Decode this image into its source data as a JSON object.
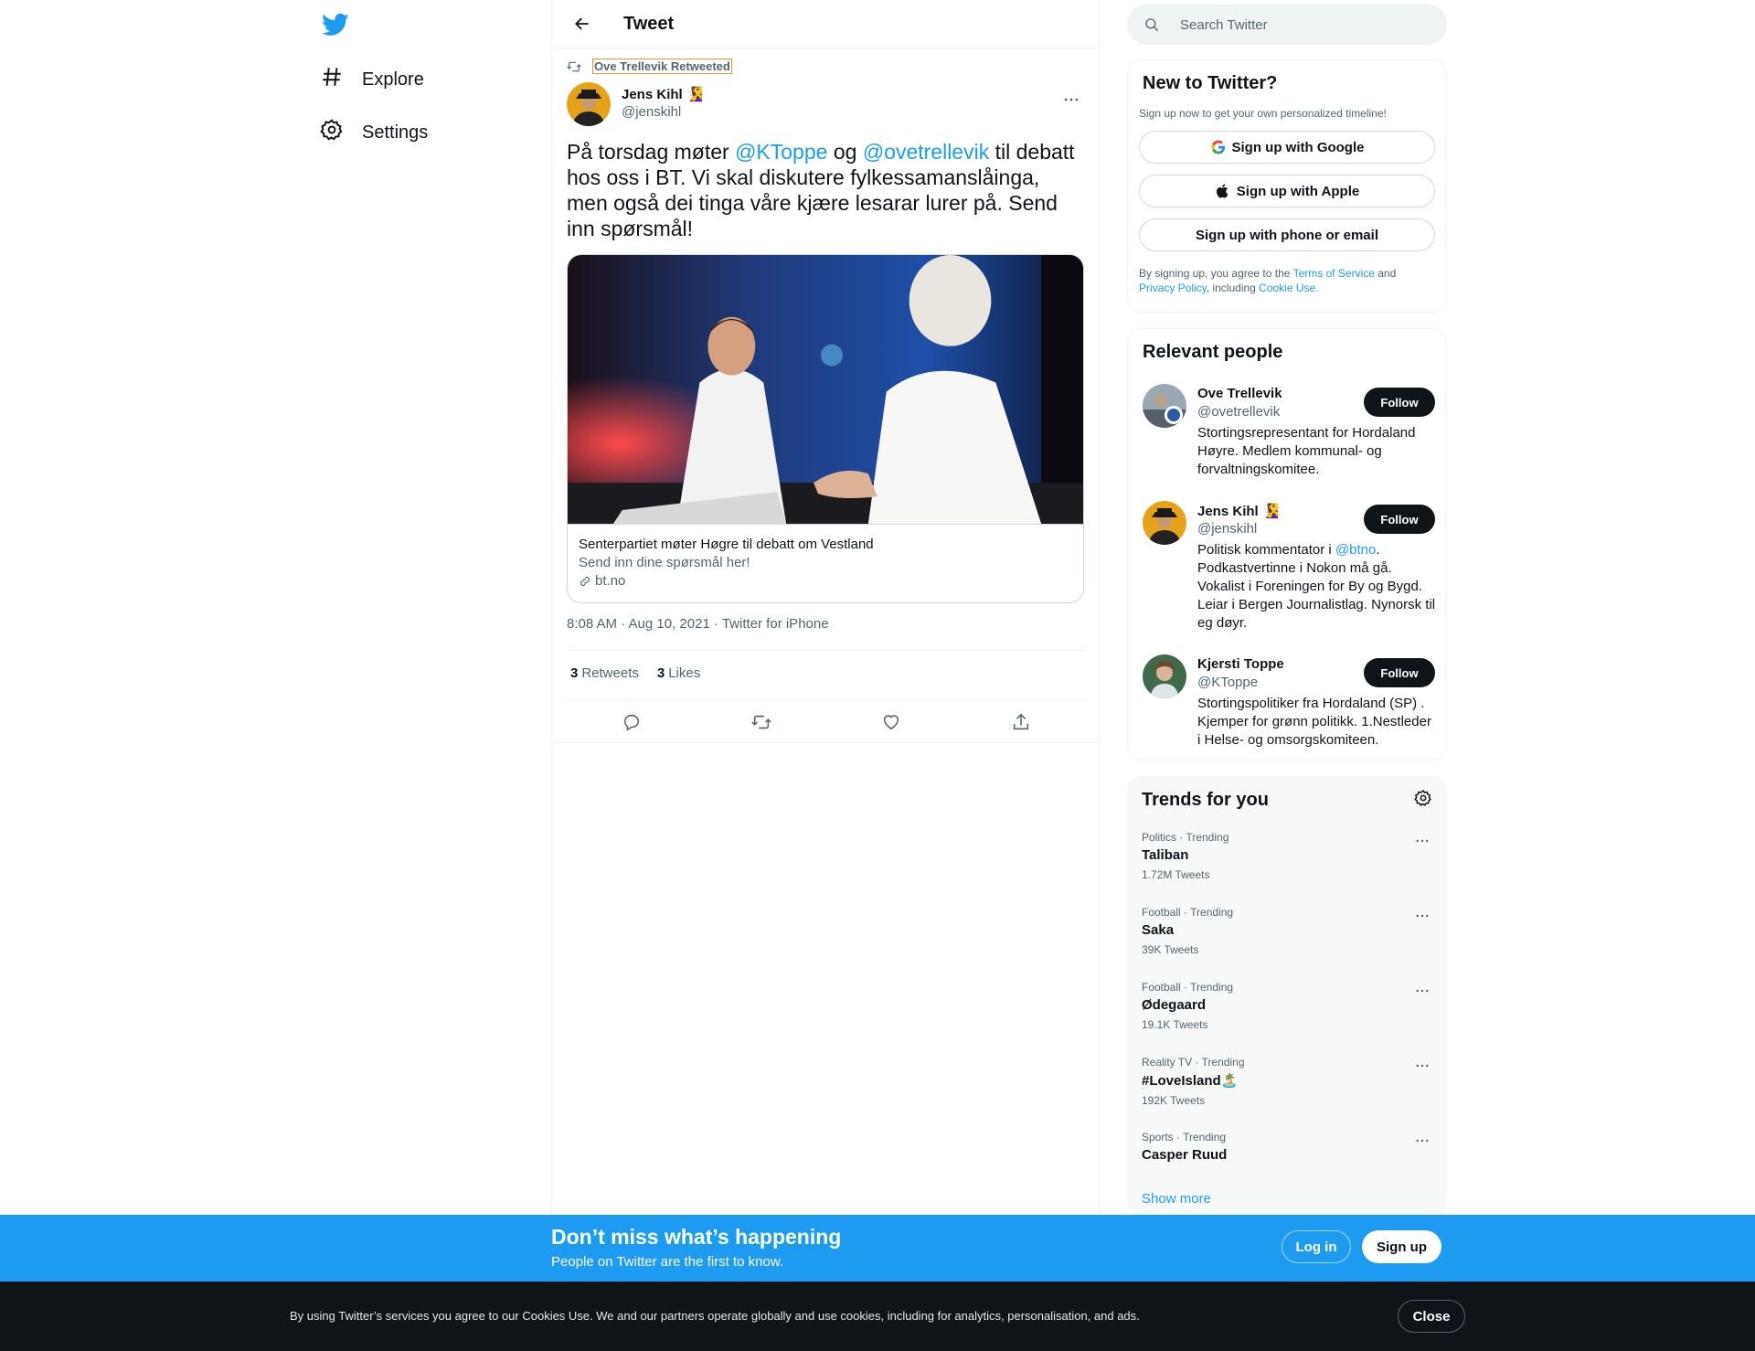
{
  "nav": {
    "logo": "twitter-bird-icon",
    "items": [
      {
        "label": "Explore",
        "icon": "hashtag-icon"
      },
      {
        "label": "Settings",
        "icon": "gear-icon"
      }
    ]
  },
  "header": {
    "title": "Tweet"
  },
  "tweet": {
    "retweeted_by": "Ove Trellevik Retweeted",
    "author_name": "Jens Kihl 🧏‍♀️",
    "author_handle": "@jenskihl",
    "text_parts": {
      "a": "På torsdag møter ",
      "m1": "@KToppe",
      "b": " og ",
      "m2": "@ovetrellevik",
      "c": " til debatt hos oss i BT. Vi skal diskutere fylkessamanslåinga, men også dei tinga våre kjære lesarar lurer på. Send inn spørsmål!"
    },
    "card": {
      "title": "Senterpartiet møter Høgre til debatt om Vestland",
      "description": "Send inn dine spørsmål her!",
      "domain": "bt.no"
    },
    "meta": "8:08 AM · Aug 10, 2021 · Twitter for iPhone",
    "retweets_count": "3",
    "retweets_label": "Retweets",
    "likes_count": "3",
    "likes_label": "Likes"
  },
  "search": {
    "placeholder": "Search Twitter"
  },
  "signup": {
    "title": "New to Twitter?",
    "subtitle": "Sign up now to get your own personalized timeline!",
    "google": "Sign up with Google",
    "apple": "Sign up with Apple",
    "phone": "Sign up with phone or email",
    "terms_a": "By signing up, you agree to the ",
    "terms_link1": "Terms of Service",
    "terms_b": " and ",
    "terms_link2": "Privacy Policy",
    "terms_c": ", including ",
    "terms_link3": "Cookie Use."
  },
  "relevant": {
    "title": "Relevant people",
    "people": [
      {
        "name": "Ove Trellevik",
        "handle": "@ovetrellevik",
        "bio": "Stortingsrepresentant for Hordaland Høyre. Medlem kommunal- og forvaltningskomitee.",
        "follow": "Follow"
      },
      {
        "name": "Jens Kihl 🧏‍♀️",
        "handle": "@jenskihl",
        "bio_a": "Politisk kommentator i ",
        "bio_link": "@btno",
        "bio_b": ". Podkastvertinne i Nokon må gå. Vokalist i Foreningen for By og Bygd. Leiar i Bergen Journalistlag. Nynorsk til eg døyr.",
        "follow": "Follow"
      },
      {
        "name": "Kjersti Toppe",
        "handle": "@KToppe",
        "bio": "Stortingspolitiker fra Hordaland (SP) . Kjemper for grønn politikk. 1.Nestleder i Helse- og omsorgskomiteen.",
        "follow": "Follow"
      }
    ]
  },
  "trends": {
    "title": "Trends for you",
    "items": [
      {
        "category": "Politics · Trending",
        "name": "Taliban",
        "count": "1.72M Tweets"
      },
      {
        "category": "Football · Trending",
        "name": "Saka",
        "count": "39K Tweets"
      },
      {
        "category": "Football · Trending",
        "name": "Ødegaard",
        "count": "19.1K Tweets"
      },
      {
        "category": "Reality TV · Trending",
        "name": "#LoveIsland🏝️",
        "count": "192K Tweets"
      },
      {
        "category": "Sports · Trending",
        "name": "Casper Ruud",
        "count": ""
      }
    ],
    "show_more": "Show more"
  },
  "banner": {
    "headline": "Don’t miss what’s happening",
    "sub": "People on Twitter are the first to know.",
    "login": "Log in",
    "signup": "Sign up"
  },
  "cookie": {
    "text": "By using Twitter’s services you agree to our Cookies Use. We and our partners operate globally and use cookies, including for analytics, personalisation, and ads.",
    "close": "Close"
  },
  "colors": {
    "accent": "#1d9bf0",
    "text": "#0f1419",
    "muted": "#536471",
    "dark": "#0f1419"
  }
}
